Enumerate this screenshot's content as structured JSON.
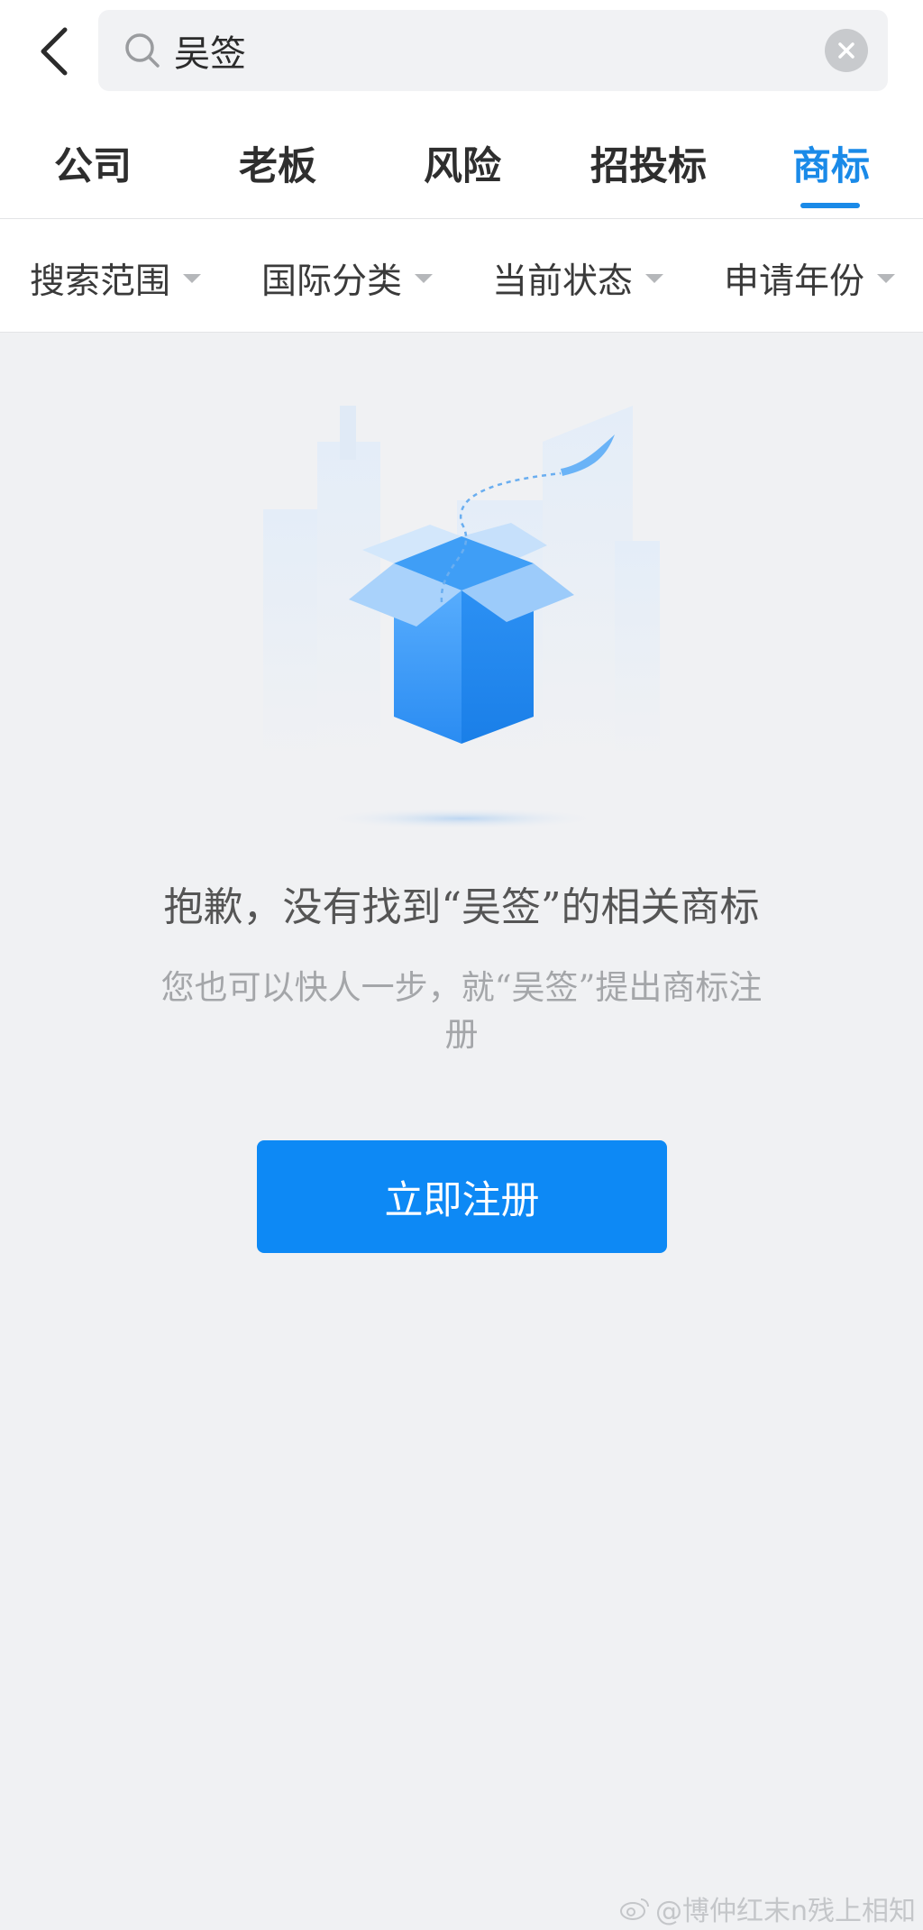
{
  "search": {
    "value": "吴签",
    "icon": "search-icon",
    "clear_icon": "clear-icon",
    "back_icon": "chevron-left-icon"
  },
  "tabs": [
    {
      "label": "公司",
      "active": false
    },
    {
      "label": "老板",
      "active": false
    },
    {
      "label": "风险",
      "active": false
    },
    {
      "label": "招投标",
      "active": false
    },
    {
      "label": "商标",
      "active": true
    }
  ],
  "filters": [
    {
      "label": "搜索范围"
    },
    {
      "label": "国际分类"
    },
    {
      "label": "当前状态"
    },
    {
      "label": "申请年份"
    }
  ],
  "empty_state": {
    "title": "抱歉，没有找到“吴签”的相关商标",
    "subtitle": "您也可以快人一步，就“吴签”提出商标注册",
    "button_label": "立即注册",
    "illustration": "open-box-illustration"
  },
  "watermark": {
    "text": "@博仲红末n残上相知"
  },
  "colors": {
    "accent": "#1a8ae8",
    "button": "#0d89f5",
    "background": "#f0f1f3"
  }
}
